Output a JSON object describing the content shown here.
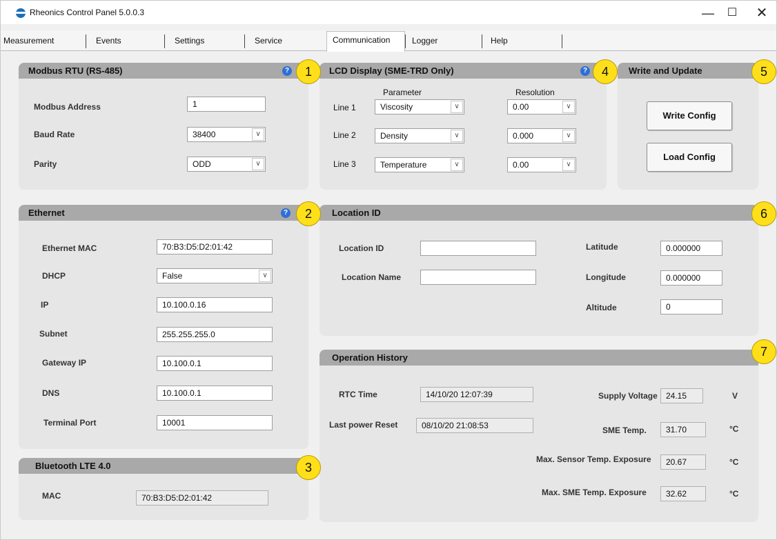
{
  "window": {
    "title": "Rheonics Control Panel 5.0.0.3",
    "controls": {
      "minimize": "—",
      "maximize": "☐",
      "close": "✕"
    }
  },
  "tabs": [
    "Measurement",
    "Events",
    "Settings",
    "Service",
    "Communication",
    "Logger",
    "Help"
  ],
  "active_tab": "Communication",
  "badges": [
    "1",
    "2",
    "3",
    "4",
    "5",
    "6",
    "7"
  ],
  "help_icon": "?",
  "modbus": {
    "title": "Modbus RTU (RS-485)",
    "address_label": "Modbus Address",
    "address_value": "1",
    "baud_label": "Baud Rate",
    "baud_value": "38400",
    "parity_label": "Parity",
    "parity_value": "ODD"
  },
  "lcd": {
    "title": "LCD Display (SME-TRD Only)",
    "parameter_header": "Parameter",
    "resolution_header": "Resolution",
    "lines": [
      {
        "label": "Line 1",
        "parameter": "Viscosity",
        "resolution": "0.00"
      },
      {
        "label": "Line 2",
        "parameter": "Density",
        "resolution": "0.000"
      },
      {
        "label": "Line 3",
        "parameter": "Temperature",
        "resolution": "0.00"
      }
    ]
  },
  "write_update": {
    "title": "Write and Update",
    "write_label": "Write Config",
    "load_label": "Load Config"
  },
  "ethernet": {
    "title": "Ethernet",
    "mac_label": "Ethernet MAC",
    "mac_value": "70:B3:D5:D2:01:42",
    "dhcp_label": "DHCP",
    "dhcp_value": "False",
    "ip_label": "IP",
    "ip_value": "10.100.0.16",
    "subnet_label": "Subnet",
    "subnet_value": "255.255.255.0",
    "gateway_label": "Gateway IP",
    "gateway_value": "10.100.0.1",
    "dns_label": "DNS",
    "dns_value": "10.100.0.1",
    "port_label": "Terminal Port",
    "port_value": "10001"
  },
  "location": {
    "title": "Location ID",
    "id_label": "Location ID",
    "id_value": "",
    "name_label": "Location Name",
    "name_value": "",
    "lat_label": "Latitude",
    "lat_value": "0.000000",
    "lon_label": "Longitude",
    "lon_value": "0.000000",
    "alt_label": "Altitude",
    "alt_value": "0"
  },
  "bluetooth": {
    "title": "Bluetooth LTE 4.0",
    "mac_label": "MAC",
    "mac_value": "70:B3:D5:D2:01:42"
  },
  "history": {
    "title": "Operation History",
    "rtc_label": "RTC Time",
    "rtc_value": "14/10/20 12:07:39",
    "reset_label": "Last power Reset",
    "reset_value": "08/10/20 21:08:53",
    "voltage_label": "Supply Voltage",
    "voltage_value": "24.15",
    "voltage_unit": "V",
    "sme_temp_label": "SME Temp.",
    "sme_temp_value": "31.70",
    "sme_temp_unit": "°C",
    "sensor_exp_label": "Max. Sensor Temp. Exposure",
    "sensor_exp_value": "20.67",
    "sensor_exp_unit": "°C",
    "sme_exp_label": "Max. SME Temp. Exposure",
    "sme_exp_value": "32.62",
    "sme_exp_unit": "°C"
  }
}
